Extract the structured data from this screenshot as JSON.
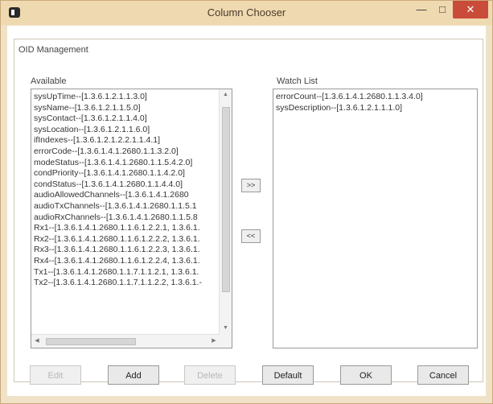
{
  "window": {
    "title": "Column Chooser",
    "minimize_glyph": "—",
    "maximize_glyph": "□",
    "close_glyph": "✕"
  },
  "group": {
    "label": "OID Management"
  },
  "available": {
    "label": "Available",
    "items": [
      "sysUpTime--[1.3.6.1.2.1.1.3.0]",
      "sysName--[1.3.6.1.2.1.1.5.0]",
      "sysContact--[1.3.6.1.2.1.1.4.0]",
      "sysLocation--[1.3.6.1.2.1.1.6.0]",
      "ifIndexes--[1.3.6.1.2.1.2.2.1.1.4.1]",
      "errorCode--[1.3.6.1.4.1.2680.1.1.3.2.0]",
      "modeStatus--[1.3.6.1.4.1.2680.1.1.5.4.2.0]",
      "condPriority--[1.3.6.1.4.1.2680.1.1.4.2.0]",
      "condStatus--[1.3.6.1.4.1.2680.1.1.4.4.0]",
      "audioAllowedChannels--[1.3.6.1.4.1.2680",
      "audioTxChannels--[1.3.6.1.4.1.2680.1.1.5.1",
      "audioRxChannels--[1.3.6.1.4.1.2680.1.1.5.8",
      "Rx1--[1.3.6.1.4.1.2680.1.1.6.1.2.2.1, 1.3.6.1.",
      "Rx2--[1.3.6.1.4.1.2680.1.1.6.1.2.2.2, 1.3.6.1.",
      "Rx3--[1.3.6.1.4.1.2680.1.1.6.1.2.2.3, 1.3.6.1.",
      "Rx4--[1.3.6.1.4.1.2680.1.1.6.1.2.2.4, 1.3.6.1.",
      "Tx1--[1.3.6.1.4.1.2680.1.1.7.1.1.2.1, 1.3.6.1.",
      "Tx2--[1.3.6.1.4.1.2680.1.1.7.1.1.2.2, 1.3.6.1.-"
    ]
  },
  "watch": {
    "label": "Watch List",
    "items": [
      "errorCount--[1.3.6.1.4.1.2680.1.1.3.4.0]",
      "sysDescription--[1.3.6.1.2.1.1.1.0]"
    ]
  },
  "movers": {
    "add_label": ">>",
    "remove_label": "<<"
  },
  "buttons": {
    "edit": "Edit",
    "add": "Add",
    "delete": "Delete",
    "default": "Default",
    "ok": "OK",
    "cancel": "Cancel"
  },
  "icons": {
    "app": "app-icon",
    "scroll_up": "arrow-up-icon",
    "scroll_down": "arrow-down-icon",
    "scroll_left": "arrow-left-icon",
    "scroll_right": "arrow-right-icon"
  }
}
